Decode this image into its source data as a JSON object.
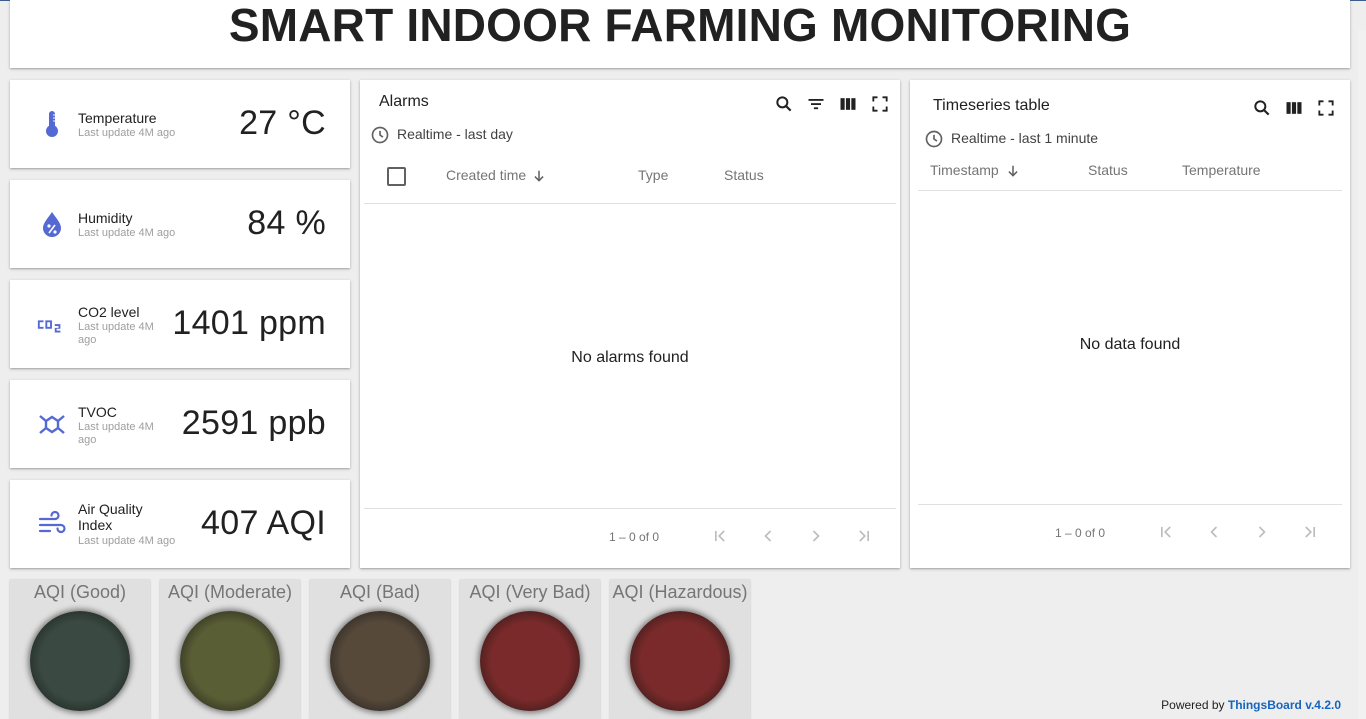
{
  "header": {
    "title": "SMART INDOOR FARMING MONITORING"
  },
  "cards": [
    {
      "label": "Temperature",
      "sub": "Last update 4M ago",
      "value": "27 °C",
      "icon": "thermometer-icon"
    },
    {
      "label": "Humidity",
      "sub": "Last update 4M ago",
      "value": "84 %",
      "icon": "humidity-drop-icon"
    },
    {
      "label": "CO2 level",
      "sub": "Last update 4M ago",
      "value": "1401 ppm",
      "icon": "co2-icon"
    },
    {
      "label": "TVOC",
      "sub": "Last update 4M ago",
      "value": "2591 ppb",
      "icon": "molecule-icon"
    },
    {
      "label": "Air Quality Index",
      "sub": "Last update 4M ago",
      "value": "407 AQI",
      "icon": "wind-icon"
    }
  ],
  "alarms": {
    "title": "Alarms",
    "timewindow": "Realtime - last day",
    "columns": [
      "Created time",
      "Type",
      "Status"
    ],
    "empty": "No alarms found",
    "pagination": "1 – 0 of 0"
  },
  "timeseries": {
    "title": "Timeseries table",
    "timewindow": "Realtime - last 1 minute",
    "columns": [
      "Timestamp",
      "Status",
      "Temperature"
    ],
    "empty": "No data found",
    "pagination": "1 – 0 of 0"
  },
  "leds": [
    {
      "label": "AQI (Good)",
      "color": "#3a4a42"
    },
    {
      "label": "AQI (Moderate)",
      "color": "#5a5e35"
    },
    {
      "label": "AQI (Bad)",
      "color": "#56493a"
    },
    {
      "label": "AQI (Very Bad)",
      "color": "#7a2a2a"
    },
    {
      "label": "AQI (Hazardous)",
      "color": "#7a2a2a"
    }
  ],
  "footer": {
    "powered_prefix": "Powered by",
    "powered_brand": "ThingsBoard v.4.2.0"
  },
  "colors": {
    "accent": "#5469d4",
    "link": "#1565c0"
  }
}
